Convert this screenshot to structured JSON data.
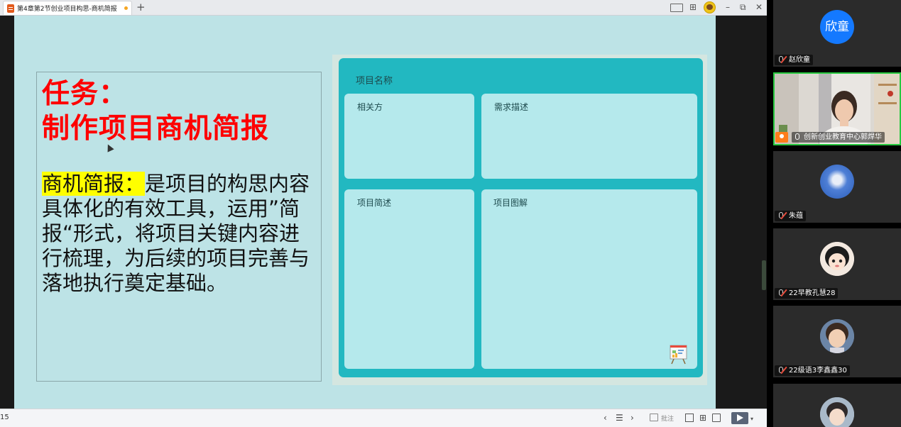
{
  "window": {
    "doc_tab_title": "第4章第2节创业项目构思-商机简报",
    "new_tab_symbol": "+",
    "controls": {
      "grid_symbol": "⊞",
      "minimize": "–",
      "maximize": "⧉",
      "close": "✕"
    }
  },
  "slide": {
    "task_heading_line1": "任务：",
    "task_heading_line2": "制作项目商机简报",
    "term": "商机简报：",
    "definition": "是项目的构思内容具体化的有效工具，运用”简报“形式，将项目关键内容进行梳理，为后续的项目完善与落地执行奠定基础。",
    "brief_template": {
      "project_name": "项目名称",
      "stakeholders": "相关方",
      "needs": "需求描述",
      "summary": "项目简述",
      "diagram": "项目图解"
    },
    "colors": {
      "background": "#bde3e6",
      "heading": "#ff0000",
      "highlight": "#ffff00",
      "panel": "#22b8c1",
      "card": "#b5e9ec"
    }
  },
  "statusbar": {
    "page_number": "15",
    "prev_symbol": "‹",
    "list_symbol": "☰",
    "next_symbol": "›",
    "notes_label": "批注",
    "sorter_symbol": "⊞",
    "play_menu_symbol": "▾"
  },
  "participants": [
    {
      "name": "赵欣童",
      "avatar_text": "欣童",
      "avatar_color": "#1479ff",
      "muted": true
    },
    {
      "name": "创新创业教育中心郭焊华",
      "camera": true,
      "host": true,
      "muted": false
    },
    {
      "name": "朱蕴",
      "muted": true
    },
    {
      "name": "22早教孔慧28",
      "muted": true
    },
    {
      "name": "22级语3李鑫鑫30",
      "muted": true
    },
    {
      "name": "",
      "muted": true
    }
  ]
}
